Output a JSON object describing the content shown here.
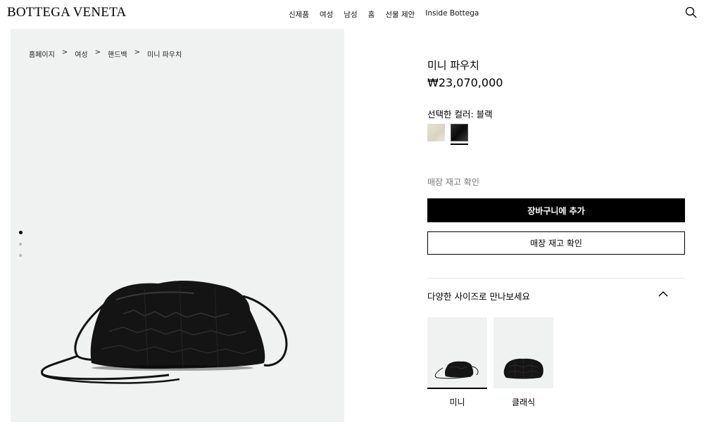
{
  "header": {
    "logo": "BOTTEGA VENETA",
    "nav": [
      "신제품",
      "여성",
      "남성",
      "홈",
      "선물 제안",
      "Inside Bottega"
    ],
    "search_icon": "search-icon"
  },
  "gallery": {
    "breadcrumb": [
      "홈페이지",
      "여성",
      "핸드백",
      "미니 파우치"
    ],
    "breadcrumb_separator": ">",
    "slide_count": 3,
    "active_slide": 1
  },
  "product": {
    "name": "미니 파우치",
    "price": "₩23,070,000",
    "color_label": "선택한 컬러: 블랙",
    "colors": [
      {
        "name": "cream",
        "hex": "#e3dfd1"
      },
      {
        "name": "black",
        "hex": "#141414",
        "selected": true
      }
    ],
    "stock_link": "매장 재고 확인",
    "add_to_cart": "장바구니에 추가",
    "check_stock": "매장 재고 확인"
  },
  "sizes": {
    "title": "다양한 사이즈로 만나보세요",
    "expand_icon": "chevron-up-icon",
    "items": [
      {
        "label": "미니",
        "selected": true
      },
      {
        "label": "클래식",
        "selected": false
      }
    ]
  },
  "colors": {
    "panel_bg": "#f0f2f1",
    "primary": "#000000",
    "muted_text": "#777777"
  }
}
